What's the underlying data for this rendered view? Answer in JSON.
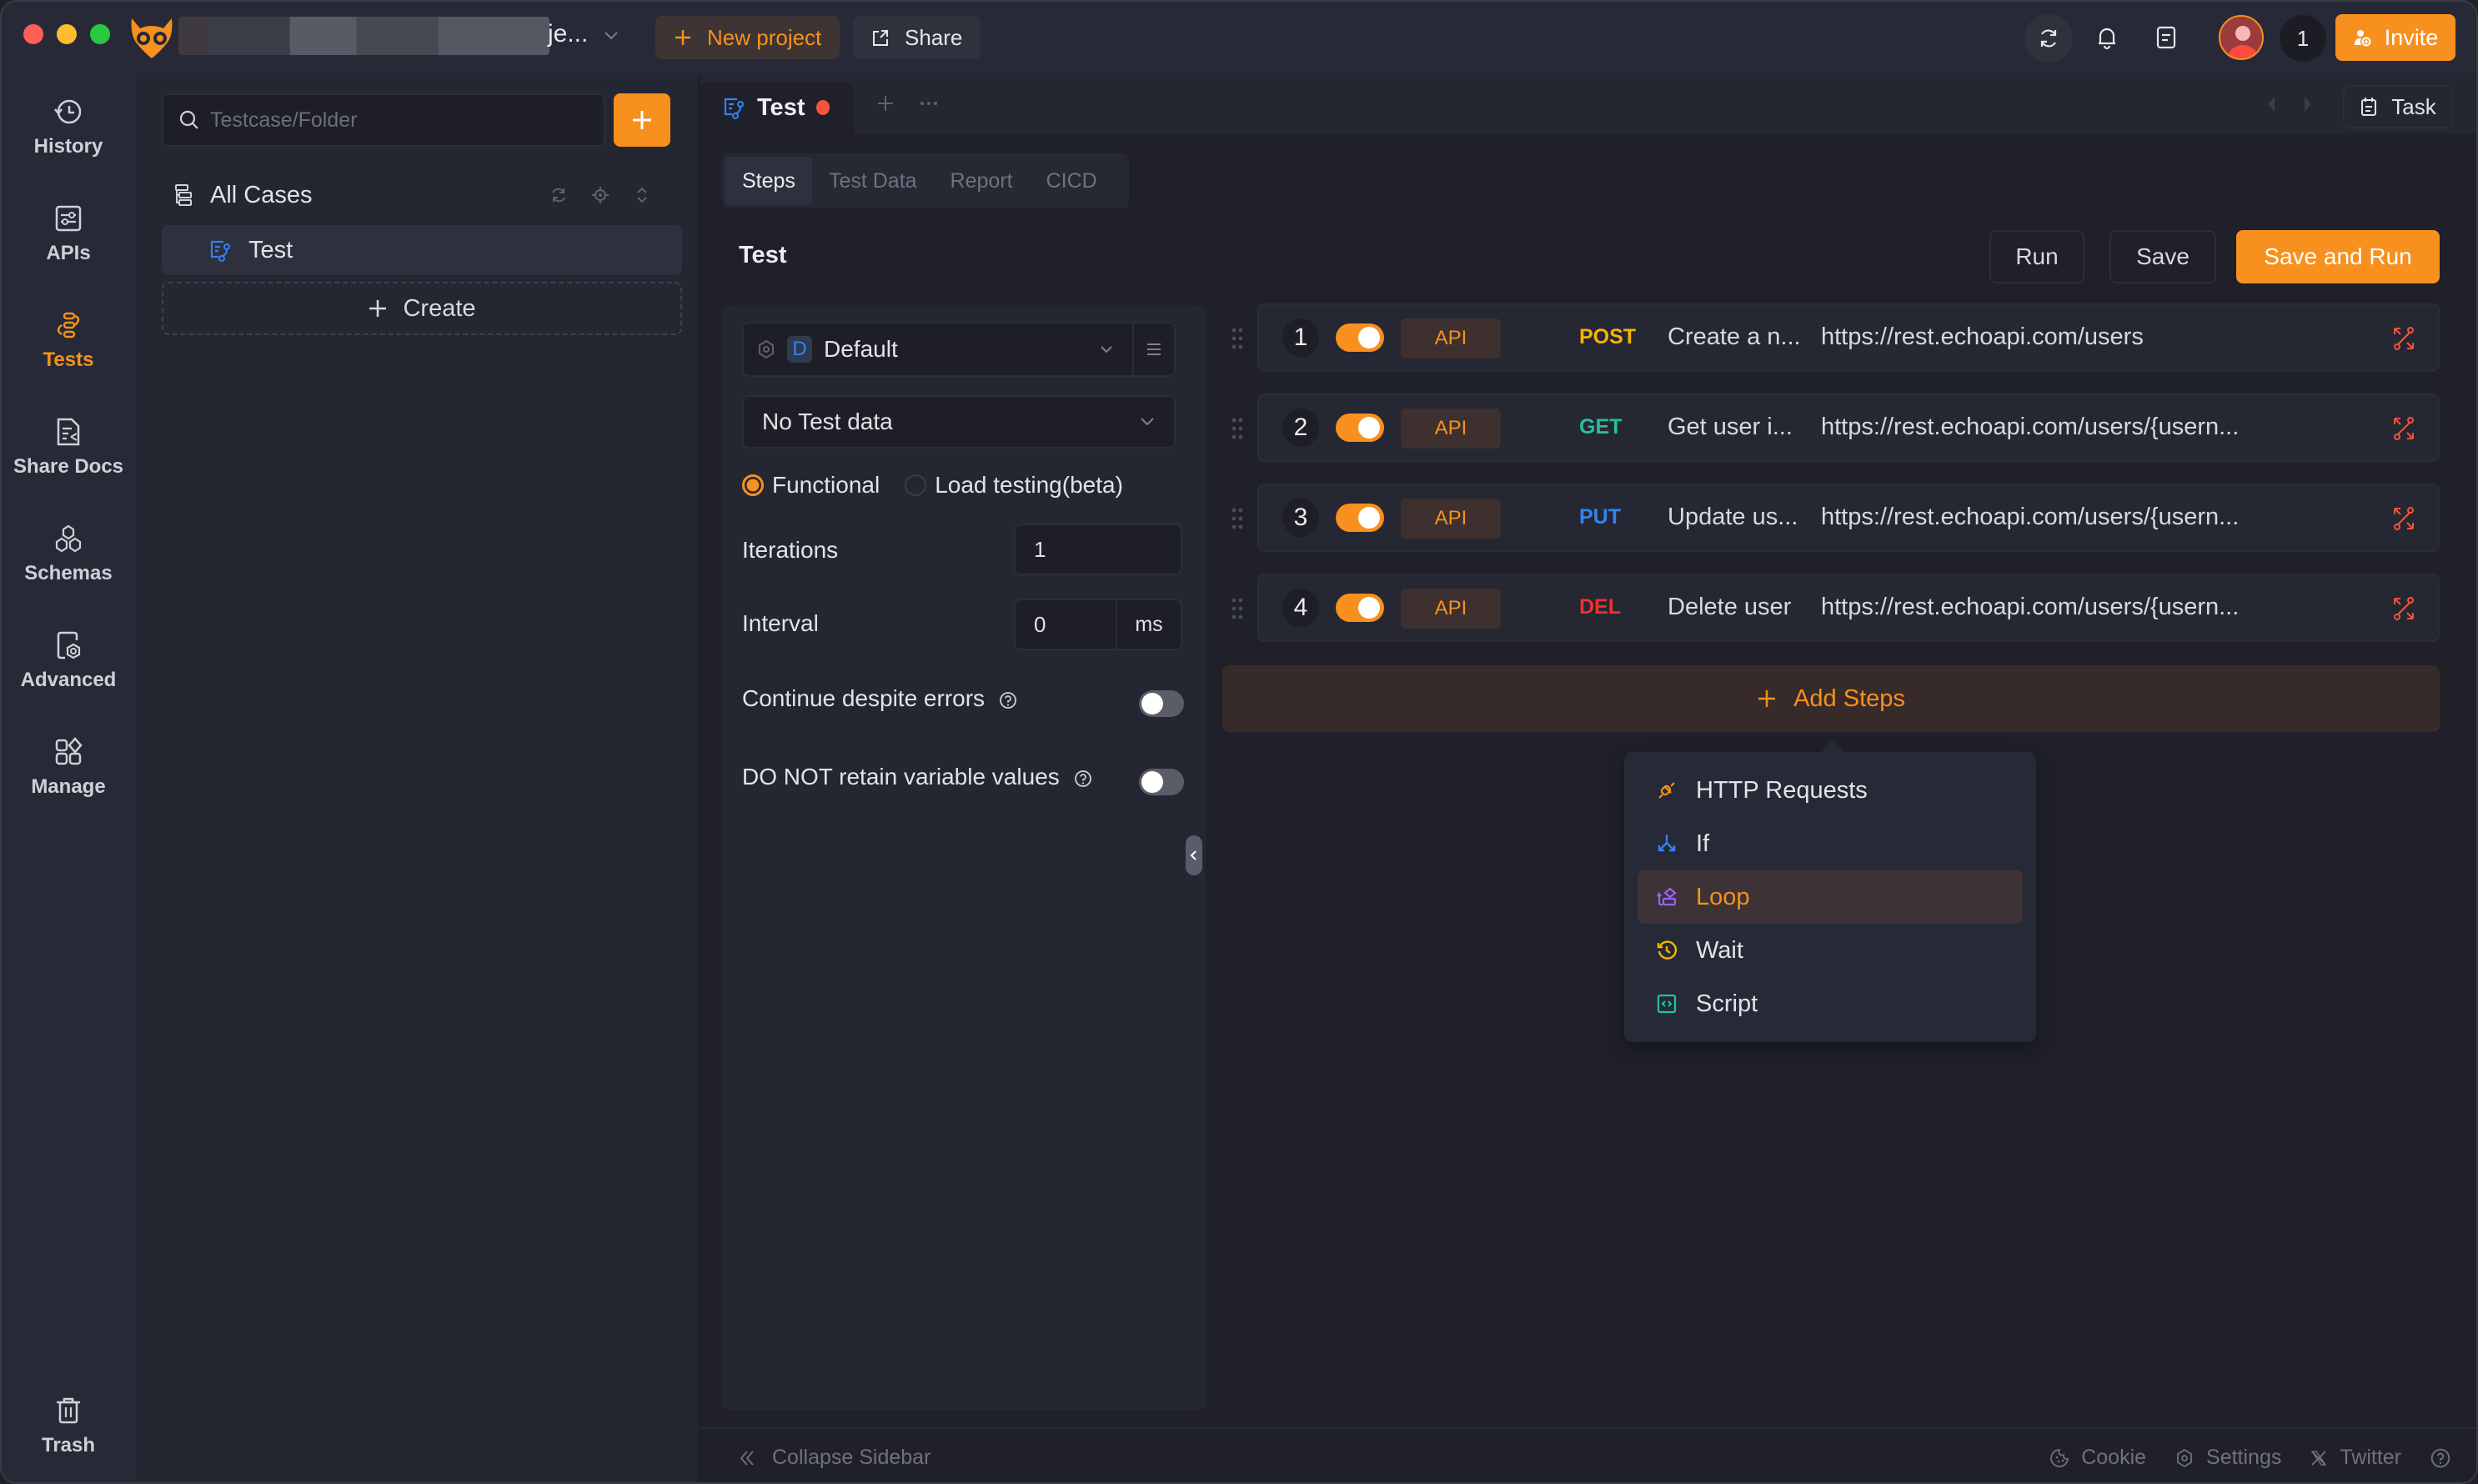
{
  "titlebar": {
    "project_name_suffix": "je...",
    "new_project_label": "New project",
    "share_label": "Share",
    "member_count": "1",
    "invite_label": "Invite"
  },
  "rail": {
    "items": [
      {
        "label": "History",
        "icon": "history-icon"
      },
      {
        "label": "APIs",
        "icon": "apis-icon"
      },
      {
        "label": "Tests",
        "icon": "tests-icon",
        "active": true
      },
      {
        "label": "Share Docs",
        "icon": "share-docs-icon"
      },
      {
        "label": "Schemas",
        "icon": "schemas-icon"
      },
      {
        "label": "Advanced",
        "icon": "advanced-icon"
      },
      {
        "label": "Manage",
        "icon": "manage-icon"
      }
    ],
    "trash_label": "Trash"
  },
  "case_sidebar": {
    "search_placeholder": "Testcase/Folder",
    "search_value": "",
    "all_cases_label": "All Cases",
    "items": [
      {
        "label": "Test",
        "selected": true
      }
    ],
    "create_label": "Create"
  },
  "tabs": {
    "open": [
      {
        "label": "Test",
        "unsaved": true
      }
    ],
    "task_label": "Task"
  },
  "sub_tabs": [
    {
      "label": "Steps",
      "active": true
    },
    {
      "label": "Test Data"
    },
    {
      "label": "Report"
    },
    {
      "label": "CICD"
    }
  ],
  "case": {
    "title": "Test",
    "run_label": "Run",
    "save_label": "Save",
    "save_and_run_label": "Save and Run"
  },
  "config": {
    "environment": {
      "badge": "D",
      "name": "Default"
    },
    "test_data": "No Test data",
    "modes": [
      {
        "label": "Functional",
        "selected": true
      },
      {
        "label": "Load testing(beta)",
        "selected": false
      }
    ],
    "iterations_label": "Iterations",
    "iterations_value": "1",
    "interval_label": "Interval",
    "interval_value": "0",
    "interval_unit": "ms",
    "continue_on_error_label": "Continue despite errors",
    "continue_on_error": false,
    "no_retain_vars_label": "DO NOT retain variable values",
    "no_retain_vars": false
  },
  "steps": [
    {
      "num": "1",
      "enabled": true,
      "type": "API",
      "method": "POST",
      "method_color": "#f7b500",
      "name": "Create a n...",
      "url": "https://rest.echoapi.com/users"
    },
    {
      "num": "2",
      "enabled": true,
      "type": "API",
      "method": "GET",
      "method_color": "#22c29a",
      "name": "Get user i...",
      "url": "https://rest.echoapi.com/users/{usern..."
    },
    {
      "num": "3",
      "enabled": true,
      "type": "API",
      "method": "PUT",
      "method_color": "#2f85f2",
      "name": "Update us...",
      "url": "https://rest.echoapi.com/users/{usern..."
    },
    {
      "num": "4",
      "enabled": true,
      "type": "API",
      "method": "DEL",
      "method_color": "#f0322a",
      "name": "Delete user",
      "url": "https://rest.echoapi.com/users/{usern..."
    }
  ],
  "add_steps_label": "Add Steps",
  "add_steps_menu": [
    {
      "label": "HTTP Requests",
      "icon": "plug-icon",
      "color": "#f7901e"
    },
    {
      "label": "If",
      "icon": "branch-icon",
      "color": "#3b7cf5"
    },
    {
      "label": "Loop",
      "icon": "loop-icon",
      "color": "#9a62f5",
      "highlighted": true
    },
    {
      "label": "Wait",
      "icon": "timer-icon",
      "color": "#f7b500"
    },
    {
      "label": "Script",
      "icon": "code-icon",
      "color": "#22c29a"
    }
  ],
  "footer": {
    "collapse_label": "Collapse Sidebar",
    "cookie_label": "Cookie",
    "settings_label": "Settings",
    "twitter_label": "Twitter"
  },
  "colors": {
    "accent": "#f7901e",
    "background": "#1f2029",
    "panel": "#242631"
  }
}
